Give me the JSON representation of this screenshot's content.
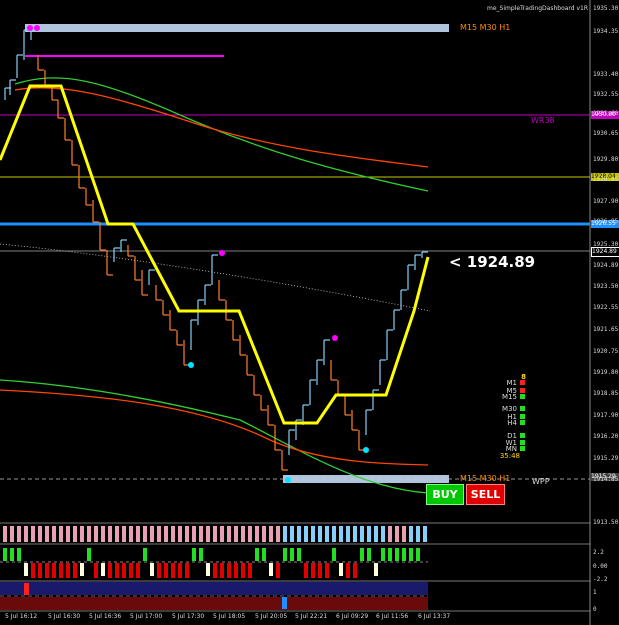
{
  "window": {
    "title": "me_SimpleTradingDashboard v1R"
  },
  "chart_labels": {
    "tf_top": "M15 M30 H1",
    "tf_bottom": "M15 M30 H1",
    "wr38": "WR38",
    "wpp": "WPP",
    "current_price_text": "< 1924.89"
  },
  "price_axis": {
    "ticks": [
      "1935.30",
      "1934.35",
      "1933.40",
      "1932.55",
      "1931.60",
      "1930.65",
      "1929.80",
      "1928.85",
      "1927.90",
      "1926.95",
      "1925.30",
      "1924.89",
      "1923.50",
      "1922.55",
      "1921.65",
      "1920.75",
      "1919.80",
      "1918.85",
      "1917.90",
      "1916.20",
      "1915.29",
      "1914.85",
      "1913.50",
      "2.2",
      "0.00",
      "-2.2",
      "1",
      "0"
    ],
    "badges": {
      "wr38": {
        "text": "1930.80",
        "color": "#c000c0"
      },
      "level": {
        "text": "1928.04",
        "color": "#c8c800"
      },
      "blue": {
        "text": "1926.55",
        "color": "#1e90ff"
      },
      "current": {
        "text": "1924.89",
        "color": "#000000"
      },
      "bottom": {
        "text": "1915.29",
        "color": "#444444"
      }
    }
  },
  "time_axis": [
    "5 Jul 16:12",
    "5 Jul 16:30",
    "5 Jul 16:36",
    "5 Jul 17:00",
    "5 Jul 17:30",
    "5 Jul 18:05",
    "5 Jul 20:05",
    "5 Jul 22:21",
    "6 Jul 09:29",
    "6 Jul 11:56",
    "6 Jul 13:37"
  ],
  "timeframes": {
    "counter": "8",
    "rows": [
      {
        "label": "M1",
        "color": "#ff2020"
      },
      {
        "label": "M5",
        "color": "#ff2020"
      },
      {
        "label": "M15",
        "color": "#20e020"
      },
      {
        "label": "M30",
        "color": "#20e020"
      },
      {
        "label": "H1",
        "color": "#20e020"
      },
      {
        "label": "H4",
        "color": "#20e020"
      },
      {
        "label": "D1",
        "color": "#20e020"
      },
      {
        "label": "W1",
        "color": "#20e020"
      },
      {
        "label": "MN",
        "color": "#20e020"
      }
    ],
    "timer": "35:48"
  },
  "buttons": {
    "buy": "BUY",
    "sell": "SELL"
  },
  "colors": {
    "buy": "#00c800",
    "sell": "#e00000",
    "supertrend": "#ffff00",
    "bull": "#87cefa",
    "bear": "#ff7f2a"
  }
}
